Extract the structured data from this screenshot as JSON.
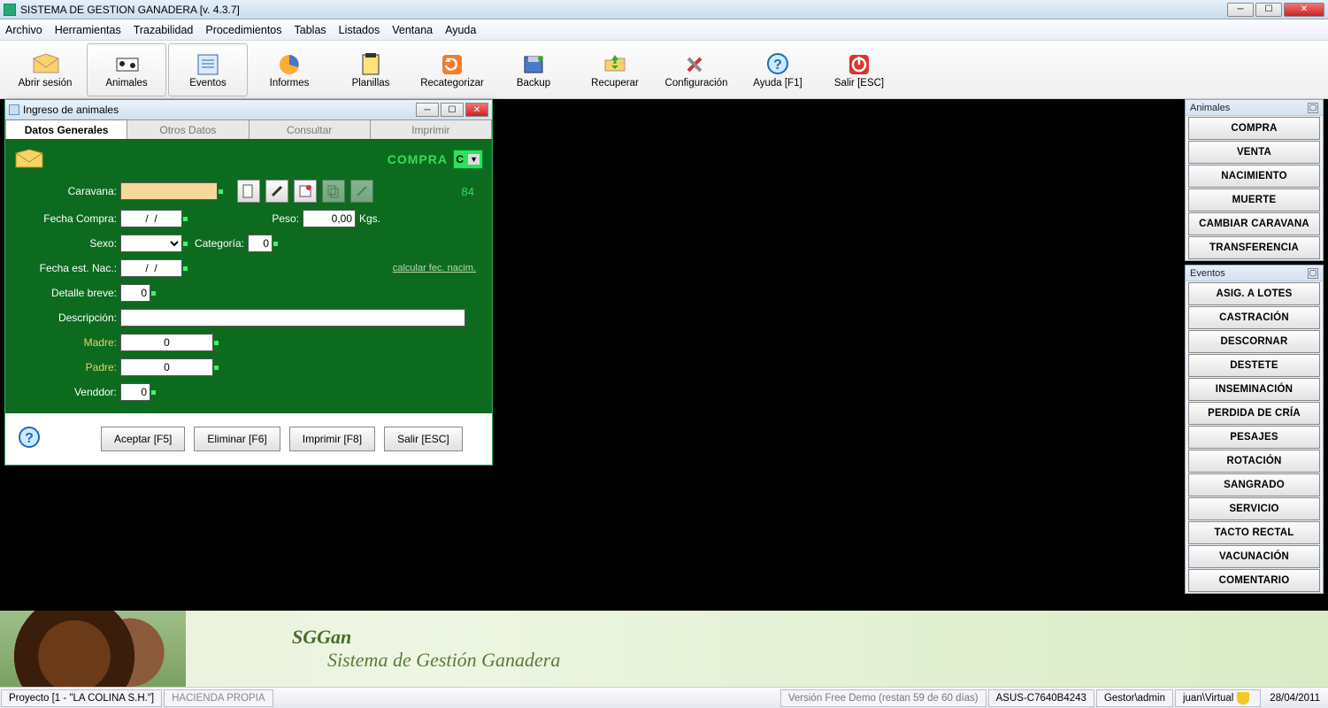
{
  "title": "SISTEMA DE GESTION GANADERA [v. 4.3.7]",
  "menus": [
    "Archivo",
    "Herramientas",
    "Trazabilidad",
    "Procedimientos",
    "Tablas",
    "Listados",
    "Ventana",
    "Ayuda"
  ],
  "toolbar": [
    {
      "label": "Abrir sesión",
      "icon": "mail"
    },
    {
      "label": "Animales",
      "icon": "cow",
      "boxed": true
    },
    {
      "label": "Eventos",
      "icon": "list",
      "boxed": true
    },
    {
      "label": "Informes",
      "icon": "pie"
    },
    {
      "label": "Planillas",
      "icon": "sheet"
    },
    {
      "label": "Recategorizar",
      "icon": "recycle"
    },
    {
      "label": "Backup",
      "icon": "disk"
    },
    {
      "label": "Recuperar",
      "icon": "folderup"
    },
    {
      "label": "Configuración",
      "icon": "tools"
    },
    {
      "label": "Ayuda [F1]",
      "icon": "help"
    },
    {
      "label": "Salir [ESC]",
      "icon": "power"
    }
  ],
  "child": {
    "title": "Ingreso de animales",
    "tabs": [
      "Datos Generales",
      "Otros Datos",
      "Consultar",
      "Imprimir"
    ],
    "activeTab": 0,
    "compra_label": "COMPRA",
    "compra_sel": "C",
    "counter": "84",
    "labels": {
      "caravana": "Caravana:",
      "fecha_compra": "Fecha Compra:",
      "peso": "Peso:",
      "kgs": "Kgs.",
      "sexo": "Sexo:",
      "categoria": "Categoría:",
      "fecha_nac": "Fecha est. Nac.:",
      "calc": "calcular fec. nacim.",
      "detalle": "Detalle breve:",
      "descripcion": "Descripción:",
      "madre": "Madre:",
      "padre": "Padre:",
      "vendedor": "Venddor:"
    },
    "values": {
      "caravana": "",
      "fecha_compra": "/  /",
      "peso": "0,00",
      "sexo": "",
      "categoria": "0",
      "fecha_nac": "/  /",
      "detalle": "0",
      "descripcion": "",
      "madre": "0",
      "padre": "0",
      "vendedor": "0"
    },
    "buttons": {
      "aceptar": "Aceptar [F5]",
      "eliminar": "Eliminar [F6]",
      "imprimir": "Imprimir [F8]",
      "salir": "Salir [ESC]"
    }
  },
  "panel_animales": {
    "title": "Animales",
    "items": [
      "COMPRA",
      "VENTA",
      "NACIMIENTO",
      "MUERTE",
      "CAMBIAR CARAVANA",
      "TRANSFERENCIA"
    ]
  },
  "panel_eventos": {
    "title": "Eventos",
    "items": [
      "ASIG. A LOTES",
      "CASTRACIÓN",
      "DESCORNAR",
      "DESTETE",
      "INSEMINACIÓN",
      "PERDIDA DE CRÍA",
      "PESAJES",
      "ROTACIÓN",
      "SANGRADO",
      "SERVICIO",
      "TACTO RECTAL",
      "VACUNACIÓN",
      "COMENTARIO"
    ]
  },
  "banner": {
    "l1": "SGGan",
    "l2": "Sistema de Gestión Ganadera"
  },
  "status": {
    "project": "Proyecto  [1 - \"LA COLINA S.H.\"]",
    "hacienda": "HACIENDA PROPIA",
    "demo": "Versión Free Demo (restan 59 de 60 días)",
    "host": "ASUS-C7640B4243",
    "user": "Gestor\\admin",
    "session": "juan\\Virtual",
    "date": "28/04/2011"
  }
}
